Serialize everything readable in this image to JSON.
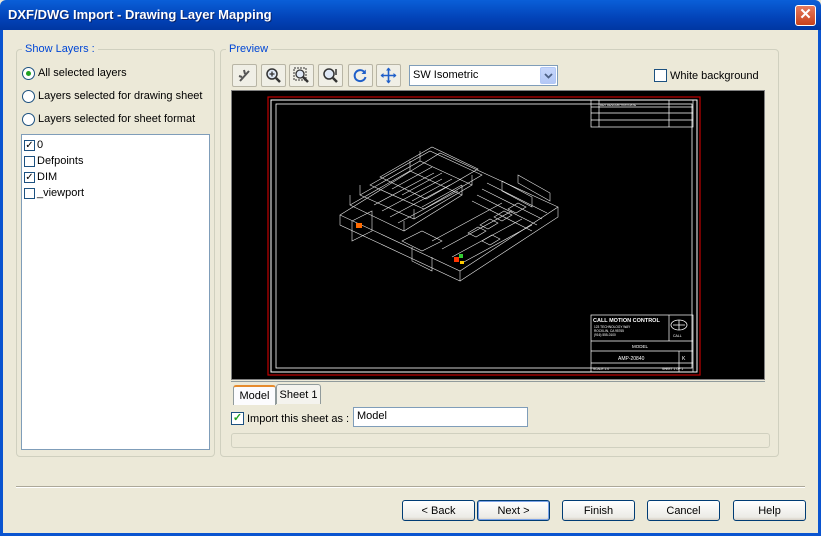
{
  "window": {
    "title": "DXF/DWG Import - Drawing Layer Mapping",
    "close": "✕"
  },
  "show_layers": {
    "label": "Show Layers :",
    "options": [
      "All selected layers",
      "Layers selected for drawing sheet",
      "Layers selected for sheet format"
    ],
    "selected_index": 0,
    "layers": [
      {
        "name": "0",
        "checked": true
      },
      {
        "name": "Defpoints",
        "checked": false
      },
      {
        "name": "DIM",
        "checked": true
      },
      {
        "name": "_viewport",
        "checked": false
      }
    ]
  },
  "preview": {
    "label": "Preview",
    "tools": [
      "pan-icon",
      "zoom-in-icon",
      "zoom-fit-icon",
      "zoom-area-icon",
      "refresh-icon",
      "move-icon"
    ],
    "view_select": "SW Isometric",
    "white_background": {
      "label": "White background",
      "checked": false
    },
    "title_block": {
      "company": "CALL MOTION CONTROL",
      "address1": "123 TECHNOLOGY WAY",
      "address2": "ROCKLIN, CA 95765",
      "phone": "(916) 555-0100",
      "logo_text": "CALL",
      "desc": "MODEL",
      "dwg_no": "AMP-20840",
      "rev": "K",
      "scale": "SCALE 1:4",
      "sheet": "SHEET 1 OF 1",
      "header_text": "REV  DESCRIPTION  DATE"
    }
  },
  "tabs": [
    "Model",
    "Sheet 1"
  ],
  "import_sheet": {
    "label": "Import this sheet as :",
    "checked": true,
    "value": "Model"
  },
  "buttons": {
    "back": "< Back",
    "next": "Next >",
    "finish": "Finish",
    "cancel": "Cancel",
    "help": "Help"
  },
  "colors": {
    "title_bar": "#0243b8",
    "group_label": "#0046d5",
    "dialog_bg": "#ece9d8",
    "preview_bg": "#000000",
    "frame_red": "#c00000"
  }
}
